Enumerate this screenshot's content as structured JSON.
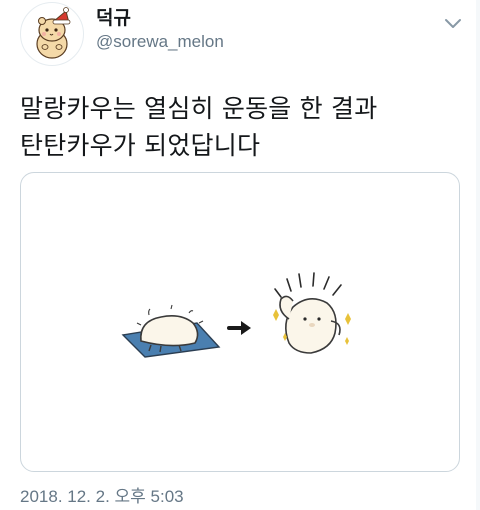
{
  "author": {
    "display_name": "덕규",
    "handle": "@sorewa_melon",
    "avatar_icon": "hamster-santa-hat-avatar"
  },
  "menu_icon": "chevron-down-icon",
  "tweet": {
    "text_line_1": "말랑카우는 열심히 운동을 한 결과",
    "text_line_2": "탄탄카우가 되었답니다"
  },
  "media": {
    "description_icons": [
      "blob-on-yoga-mat",
      "arrow-right-icon",
      "flexing-blob-with-sparkles"
    ]
  },
  "timestamp": "2018. 12. 2. 오후 5:03",
  "colors": {
    "text": "#14171a",
    "secondary": "#657786",
    "border": "#ccd6dd",
    "mat": "#4a7fb0",
    "sparkle": "#e8c23a",
    "santa_hat": "#d63a2f"
  }
}
